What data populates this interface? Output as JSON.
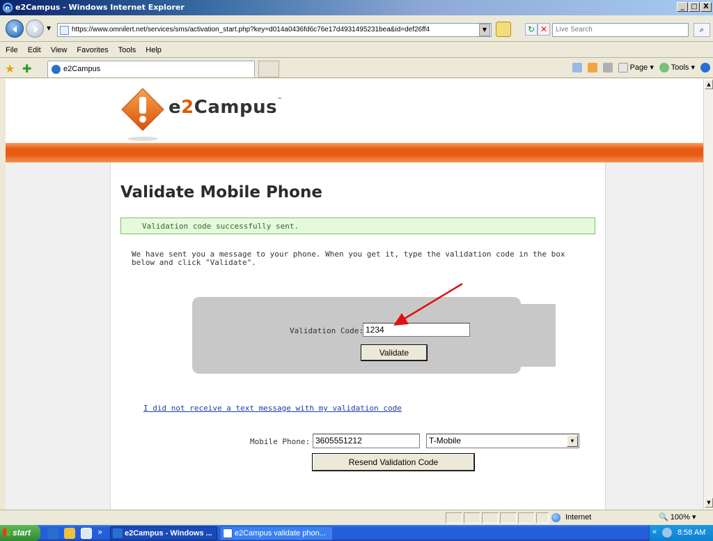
{
  "window": {
    "title": "e2Campus - Windows Internet Explorer",
    "min": "_",
    "max": "□",
    "close": "X"
  },
  "address": {
    "url": "https://www.omnilert.net/services/sms/activation_start.php?key=d014a0436fd6c76e17d4931495231bea&id=def26ff4",
    "search_placeholder": "Live Search"
  },
  "menu": [
    "File",
    "Edit",
    "View",
    "Favorites",
    "Tools",
    "Help"
  ],
  "tab": {
    "label": "e2Campus"
  },
  "commandbar": {
    "page": "Page",
    "tools": "Tools"
  },
  "page": {
    "brand": {
      "prefix": "e",
      "two": "2",
      "suffix": "Campus",
      "tm": "™"
    },
    "heading": "Validate Mobile Phone",
    "alert": "Validation code successfully sent.",
    "message": "We have sent you a message to your phone. When you get it, type the validation code in the box below and click \"Validate\".",
    "validation_label": "Validation Code:",
    "validation_value": "1234",
    "validate_button": "Validate",
    "no_code_link": "I did not receive a text message with my validation code",
    "mobile_label": "Mobile Phone:",
    "mobile_value": "3605551212",
    "carrier_value": "T-Mobile",
    "resend_button": "Resend Validation Code"
  },
  "status": {
    "zone": "Internet",
    "zoom": "100%"
  },
  "taskbar": {
    "start": "start",
    "tasks": [
      "e2Campus - Windows ...",
      "e2Campus validate phon..."
    ],
    "clock": "8:58 AM"
  },
  "colors": {
    "accent_orange": "#e65a12",
    "alert_green": "#e6f9dd",
    "link_blue": "#1a3fa8"
  }
}
